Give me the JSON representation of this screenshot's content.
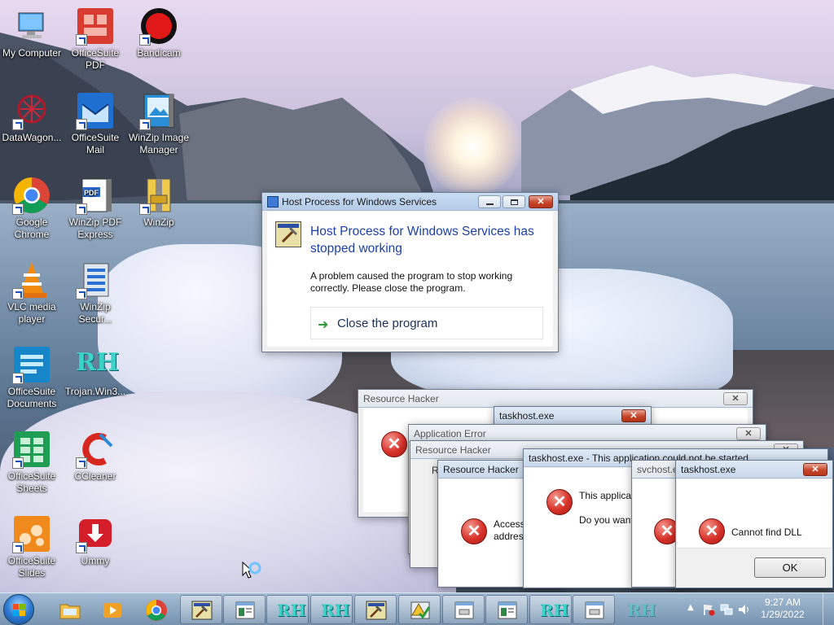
{
  "desktop": {
    "icons": [
      {
        "label": "My Computer"
      },
      {
        "label": "OfficeSuite PDF"
      },
      {
        "label": "Bandicam"
      },
      {
        "label": "DataWagon..."
      },
      {
        "label": "OfficeSuite Mail"
      },
      {
        "label": "WinZip Image Manager"
      },
      {
        "label": "Google Chrome"
      },
      {
        "label": "WinZip PDF Express"
      },
      {
        "label": "WinZip"
      },
      {
        "label": "VLC media player"
      },
      {
        "label": "WinZip Secur..."
      },
      {
        "label": "OfficeSuite Documents"
      },
      {
        "label": "Trojan.Win3..."
      },
      {
        "label": "OfficeSuite Sheets"
      },
      {
        "label": "CCleaner"
      },
      {
        "label": "OfficeSuite Slides"
      },
      {
        "label": "Ummy"
      }
    ]
  },
  "host_dialog": {
    "title": "Host Process for Windows Services",
    "heading": "Host Process for Windows Services has stopped working",
    "message": "A problem caused the program to stop working correctly. Please close the program.",
    "action": "Close the program"
  },
  "error_windows": {
    "resource_hacker_1": {
      "title": "Resource Hacker"
    },
    "taskhost_small": {
      "title": "taskhost.exe"
    },
    "application_error": {
      "title": "Application Error"
    },
    "resource_hacker_2": {
      "title": "Resource Hacker",
      "peek": "R"
    },
    "resource_hacker_3": {
      "title": "Resource Hacker",
      "text": "Access address"
    },
    "taskhost_app": {
      "title": "taskhost.exe - This application could not be started",
      "text1": "This applica",
      "text2": "Do you want"
    },
    "svchost": {
      "title": "svchost.ex"
    },
    "taskhost_dll": {
      "title": "taskhost.exe",
      "text": "Cannot find DLL",
      "ok": "OK"
    }
  },
  "taskbar": {
    "clock_time": "9:27 AM",
    "clock_date": "1/29/2022",
    "tray_up": "▲"
  },
  "colors": {
    "heading_blue": "#1c3fa8",
    "close_red": "#c7452a",
    "rh_cyan": "#3bd3c8"
  }
}
